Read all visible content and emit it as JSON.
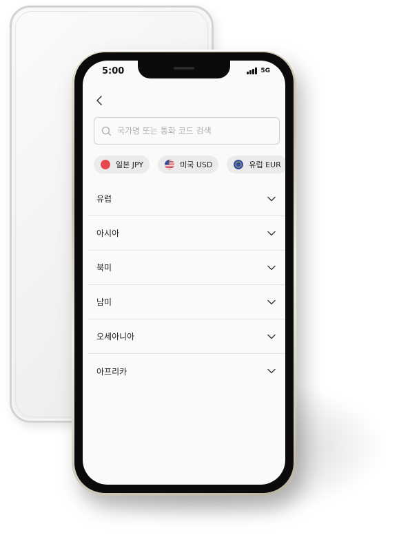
{
  "status_bar": {
    "time": "5:00",
    "network": "5G"
  },
  "search": {
    "placeholder": "국가명 또는 통화 코드 검색",
    "value": ""
  },
  "quick_currencies": [
    {
      "label": "일본 JPY",
      "flag": "japan-flag-icon",
      "color": "#e5484d"
    },
    {
      "label": "미국 USD",
      "flag": "usa-flag-icon",
      "color": "#3b4f9a"
    },
    {
      "label": "유럽 EUR",
      "flag": "eu-flag-icon",
      "color": "#2f4ea3"
    }
  ],
  "regions": [
    {
      "label": "유럽"
    },
    {
      "label": "아시아"
    },
    {
      "label": "북미"
    },
    {
      "label": "남미"
    },
    {
      "label": "오세아니아"
    },
    {
      "label": "아프리카"
    }
  ]
}
